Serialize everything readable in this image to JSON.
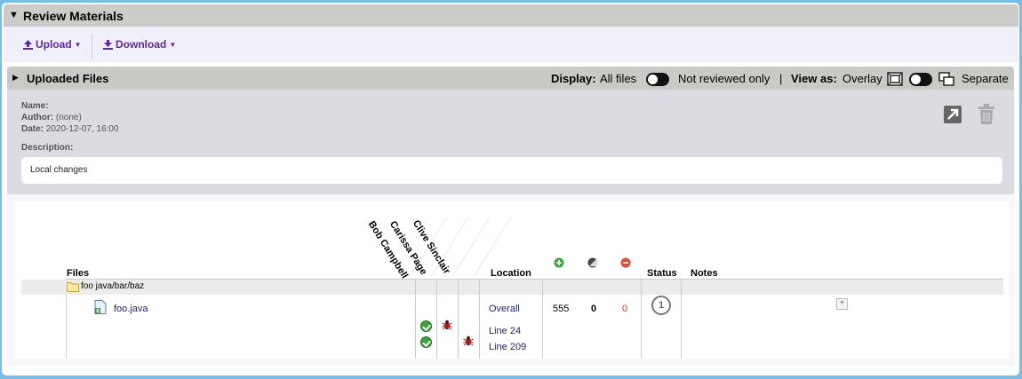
{
  "header": {
    "title": "Review Materials"
  },
  "toolbar": {
    "upload_label": "Upload",
    "download_label": "Download"
  },
  "panel": {
    "title": "Uploaded Files",
    "display_label": "Display:",
    "display_option_all": "All files",
    "display_option_unreviewed": "Not reviewed only",
    "separator": "|",
    "view_as_label": "View as:",
    "view_option_overlay": "Overlay",
    "view_option_separate": "Separate"
  },
  "info": {
    "name_label": "Name:",
    "name_value": "",
    "author_label": "Author:",
    "author_value": "(none)",
    "date_label": "Date:",
    "date_value": "2020-12-07, 16:00",
    "description_label": "Description:",
    "description_value": "Local changes"
  },
  "table": {
    "col_files": "Files",
    "col_location": "Location",
    "col_status": "Status",
    "col_notes": "Notes",
    "reviewers": [
      "Bob Campbell",
      "Carissa Page",
      "Clive Sinclair"
    ],
    "folder": "foo java/bar/baz",
    "file": {
      "name": "foo.java",
      "locations": [
        "Overall",
        "Line 24",
        "Line 209"
      ],
      "added": "555",
      "changed": "0",
      "removed": "0",
      "status": "1"
    }
  },
  "colors": {
    "accent": "#5e2a9d",
    "link": "#1b1b8a",
    "added": "#3aa33a",
    "removed": "#e04a3a"
  }
}
